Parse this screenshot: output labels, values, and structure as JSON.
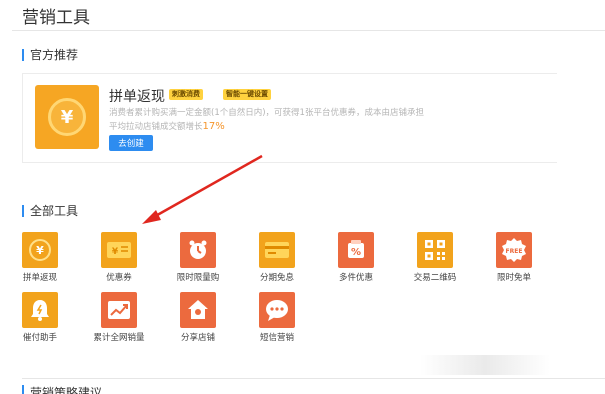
{
  "page": {
    "title": "营销工具"
  },
  "sections": {
    "official": "官方推荐",
    "all": "全部工具",
    "bottom": "营销策略建议"
  },
  "recommended": {
    "name": "拼单返现",
    "badges": [
      "刺激消费",
      "智能一键设置"
    ],
    "desc_main": "消费者累计购买满一定金额(1个自然日内)，可获得1张平台优惠券，成本由店铺承担",
    "desc_growth": "平均拉动店铺成交额增长",
    "growth_pct": "17%",
    "button": "去创建"
  },
  "tools": [
    {
      "label": "拼单返现",
      "color": "#f2a31c",
      "icon": "coin-return-icon"
    },
    {
      "label": "优惠券",
      "color": "#f2a31c",
      "icon": "coupon-icon"
    },
    {
      "label": "限时限量购",
      "color": "#ec6a3e",
      "icon": "clock-icon"
    },
    {
      "label": "分期免息",
      "color": "#f2a31c",
      "icon": "card-icon"
    },
    {
      "label": "多件优惠",
      "color": "#ec6a3e",
      "icon": "discount-icon"
    },
    {
      "label": "交易二维码",
      "color": "#f2a31c",
      "icon": "qrcode-icon"
    },
    {
      "label": "限时免单",
      "color": "#ec6a3e",
      "icon": "free-icon"
    },
    {
      "label": "催付助手",
      "color": "#f2a31c",
      "icon": "bell-icon"
    },
    {
      "label": "累计全网销量",
      "color": "#ec6a3e",
      "icon": "trend-icon"
    },
    {
      "label": "分享店铺",
      "color": "#ec6a3e",
      "icon": "share-shop-icon"
    },
    {
      "label": "短信营销",
      "color": "#ec6a3e",
      "icon": "sms-icon"
    }
  ],
  "free_icon_text": "FREE",
  "discount_icon_text": "%",
  "coin_symbol": "¥"
}
